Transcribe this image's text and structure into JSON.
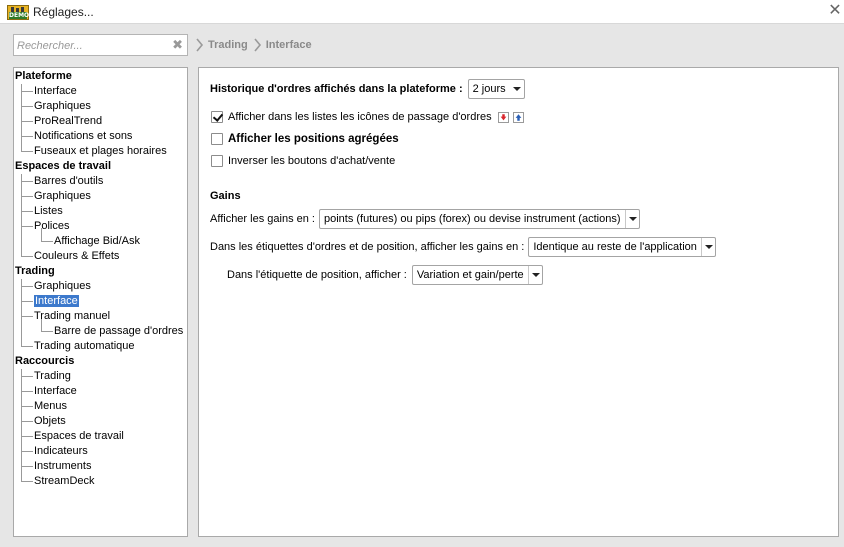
{
  "window": {
    "title": "Réglages...",
    "app_badge": "DEMO"
  },
  "search": {
    "placeholder": "Rechercher..."
  },
  "breadcrumb": [
    "Trading",
    "Interface"
  ],
  "tree": {
    "categories": [
      {
        "label": "Plateforme",
        "items": [
          "Interface",
          "Graphiques",
          "ProRealTrend",
          "Notifications et sons",
          "Fuseaux et plages horaires"
        ]
      },
      {
        "label": "Espaces de travail",
        "items": [
          "Barres d'outils",
          "Graphiques",
          "Listes",
          "Polices",
          "Affichage Bid/Ask",
          "Couleurs & Effets"
        ]
      },
      {
        "label": "Trading",
        "items": [
          "Graphiques",
          "Interface",
          "Trading manuel",
          "Barre de passage d'ordres",
          "Trading automatique"
        ]
      },
      {
        "label": "Raccourcis",
        "items": [
          "Trading",
          "Interface",
          "Menus",
          "Objets",
          "Espaces de travail",
          "Indicateurs",
          "Instruments",
          "StreamDeck"
        ]
      }
    ],
    "selected": "Trading > Interface"
  },
  "settings": {
    "history_label": "Historique d'ordres affichés dans la plateforme :",
    "history_value": "2 jours",
    "show_icons_label": "Afficher dans les listes les icônes de passage d'ordres",
    "show_icons_checked": true,
    "aggregated_label": "Afficher les positions agrégées",
    "aggregated_checked": false,
    "invert_label": "Inverser les boutons d'achat/vente",
    "invert_checked": false,
    "gains_heading": "Gains",
    "gains_label": "Afficher les gains en :",
    "gains_value": "points (futures) ou pips (forex) ou devise instrument (actions)",
    "labels_gains_label": "Dans les étiquettes d'ordres et de position, afficher les gains en :",
    "labels_gains_value": "Identique au reste de l'application",
    "position_label_label": "Dans l'étiquette de position, afficher :",
    "position_label_value": "Variation et gain/perte"
  },
  "colors": {
    "selection": "#3c79cc",
    "sell_icon": "#d9262c",
    "buy_icon": "#2a5fb5",
    "badge_green": "#2f7b28",
    "badge_yellow": "#e8b323"
  }
}
